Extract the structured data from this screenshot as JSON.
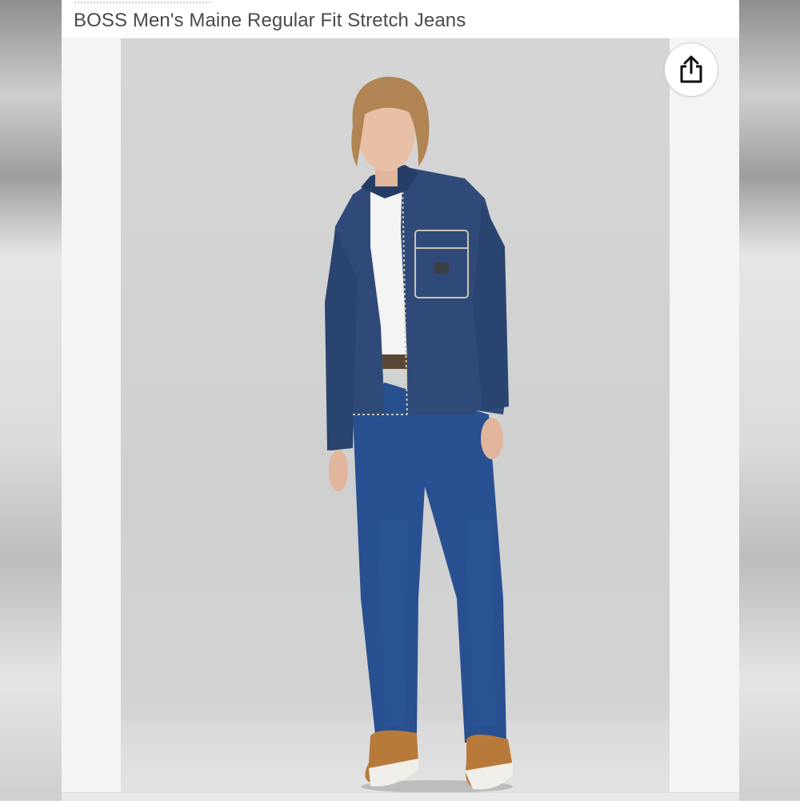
{
  "product": {
    "title": "BOSS Men's Maine Regular Fit Stretch Jeans"
  },
  "image": {
    "subject": "model-in-denim-outfit"
  },
  "share_button": {
    "icon": "share-icon"
  },
  "colors": {
    "denim_jacket": "#2f4a78",
    "jeans": "#284f8f",
    "background": "#d2d2d2"
  }
}
